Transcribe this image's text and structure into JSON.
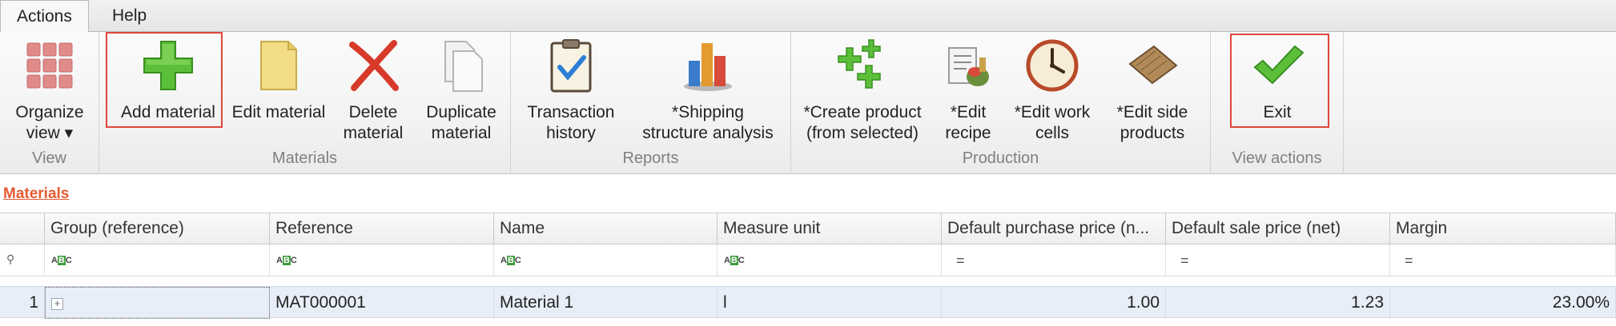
{
  "menu": {
    "tabs": [
      {
        "label": "Actions"
      },
      {
        "label": "Help"
      }
    ]
  },
  "ribbon": {
    "groups": {
      "view": {
        "label": "View",
        "organize_view": "Organize\nview ▾"
      },
      "materials": {
        "label": "Materials",
        "add": "Add material",
        "edit": "Edit material",
        "delete": "Delete\nmaterial",
        "duplicate": "Duplicate\nmaterial"
      },
      "reports": {
        "label": "Reports",
        "transaction_history": "Transaction\nhistory",
        "shipping_analysis": "*Shipping\nstructure analysis"
      },
      "production": {
        "label": "Production",
        "create_product": "*Create product\n(from selected)",
        "edit_recipe": "*Edit\nrecipe",
        "edit_work_cells": "*Edit work\ncells",
        "edit_side_products": "*Edit side\nproducts"
      },
      "view_actions": {
        "label": "View actions",
        "exit": "Exit"
      }
    }
  },
  "materials_title": "Materials",
  "grid": {
    "columns": [
      "Group (reference)",
      "Reference",
      "Name",
      "Measure unit",
      "Default purchase price (n...",
      "Default sale price (net)",
      "Margin"
    ],
    "rows": [
      {
        "index": "1",
        "group": "",
        "reference": "MAT000001",
        "name": "Material 1",
        "unit": "l",
        "purchase": "1.00",
        "sale": "1.23",
        "margin": "23.00%"
      }
    ]
  },
  "colors": {
    "highlight": "#e0463a",
    "title": "#e85a32",
    "selected_row": "#e7eef8"
  }
}
